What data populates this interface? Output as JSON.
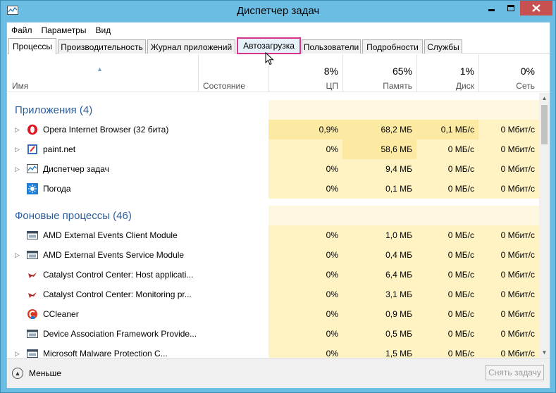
{
  "window": {
    "title": "Диспетчер задач"
  },
  "menu": [
    "Файл",
    "Параметры",
    "Вид"
  ],
  "tabs": [
    {
      "label": "Процессы",
      "state": "active"
    },
    {
      "label": "Производительность",
      "state": "normal"
    },
    {
      "label": "Журнал приложений",
      "state": "normal"
    },
    {
      "label": "Автозагрузка",
      "state": "highlighted"
    },
    {
      "label": "Пользователи",
      "state": "normal"
    },
    {
      "label": "Подробности",
      "state": "normal"
    },
    {
      "label": "Службы",
      "state": "normal"
    }
  ],
  "columns": {
    "name": "Имя",
    "state": "Состояние",
    "cpu": {
      "pct": "8%",
      "label": "ЦП"
    },
    "mem": {
      "pct": "65%",
      "label": "Память"
    },
    "disk": {
      "pct": "1%",
      "label": "Диск"
    },
    "net": {
      "pct": "0%",
      "label": "Сеть"
    }
  },
  "groups": [
    {
      "title": "Приложения (4)",
      "rows": [
        {
          "name": "Opera Internet Browser (32 бита)",
          "icon": "opera-icon",
          "expandable": true,
          "cpu": "0,9%",
          "mem": "68,2 МБ",
          "disk": "0,1 МБ/с",
          "net": "0 Мбит/с"
        },
        {
          "name": "paint.net",
          "icon": "paintnet-icon",
          "expandable": true,
          "cpu": "0%",
          "mem": "58,6 МБ",
          "disk": "0 МБ/с",
          "net": "0 Мбит/с"
        },
        {
          "name": "Диспетчер задач",
          "icon": "task-manager-icon",
          "expandable": true,
          "cpu": "0%",
          "mem": "9,4 МБ",
          "disk": "0 МБ/с",
          "net": "0 Мбит/с"
        },
        {
          "name": "Погода",
          "icon": "weather-icon",
          "expandable": false,
          "cpu": "0%",
          "mem": "0,1 МБ",
          "disk": "0 МБ/с",
          "net": "0 Мбит/с"
        }
      ]
    },
    {
      "title": "Фоновые процессы (46)",
      "rows": [
        {
          "name": "AMD External Events Client Module",
          "icon": "service-window-icon",
          "expandable": false,
          "cpu": "0%",
          "mem": "1,0 МБ",
          "disk": "0 МБ/с",
          "net": "0 Мбит/с"
        },
        {
          "name": "AMD External Events Service Module",
          "icon": "service-window-icon",
          "expandable": true,
          "cpu": "0%",
          "mem": "0,4 МБ",
          "disk": "0 МБ/с",
          "net": "0 Мбит/с"
        },
        {
          "name": "Catalyst Control Center: Host applicati...",
          "icon": "catalyst-icon",
          "expandable": false,
          "cpu": "0%",
          "mem": "6,4 МБ",
          "disk": "0 МБ/с",
          "net": "0 Мбит/с"
        },
        {
          "name": "Catalyst Control Center: Monitoring pr...",
          "icon": "catalyst-icon",
          "expandable": false,
          "cpu": "0%",
          "mem": "3,1 МБ",
          "disk": "0 МБ/с",
          "net": "0 Мбит/с"
        },
        {
          "name": "CCleaner",
          "icon": "ccleaner-icon",
          "expandable": false,
          "cpu": "0%",
          "mem": "0,9 МБ",
          "disk": "0 МБ/с",
          "net": "0 Мбит/с"
        },
        {
          "name": "Device Association Framework Provide...",
          "icon": "service-window-icon",
          "expandable": false,
          "cpu": "0%",
          "mem": "0,5 МБ",
          "disk": "0 МБ/с",
          "net": "0 Мбит/с"
        },
        {
          "name": "Microsoft Malware Protection C...",
          "icon": "service-window-icon",
          "expandable": true,
          "cpu": "0%",
          "mem": "1,5 МБ",
          "disk": "0 МБ/с",
          "net": "0 Мбит/с"
        }
      ]
    }
  ],
  "footer": {
    "less_label": "Меньше",
    "end_task_label": "Снять задачу"
  }
}
